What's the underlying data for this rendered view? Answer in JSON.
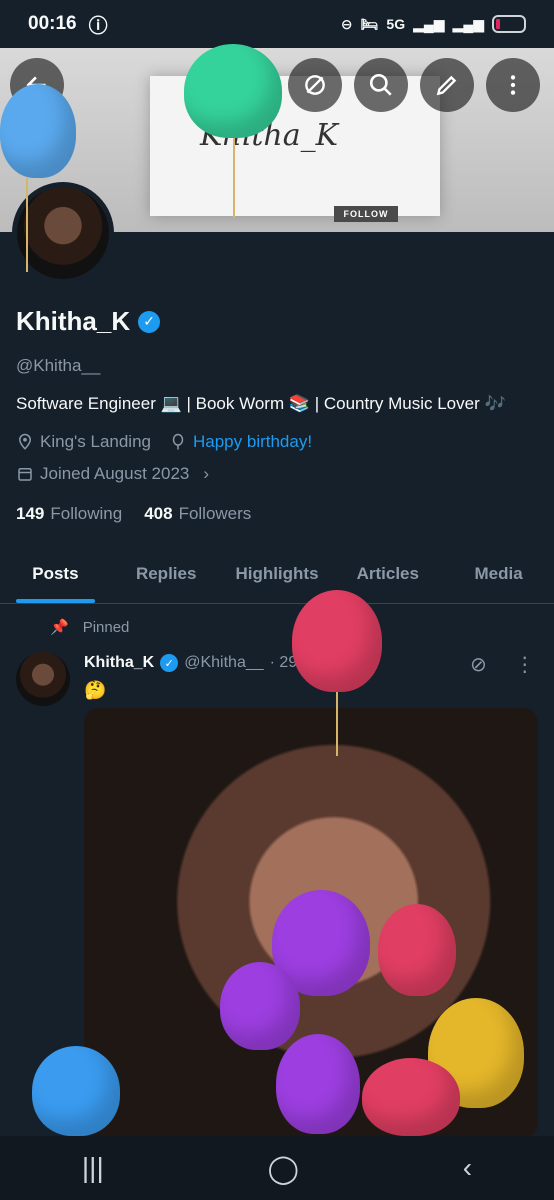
{
  "status_bar": {
    "time": "00:16",
    "network": "5G"
  },
  "banner": {
    "name_text": "Khitha_K",
    "follow_text": "FOLLOW"
  },
  "profile": {
    "display_name": "Khitha_K",
    "handle": "@Khitha__",
    "bio": "Software Engineer 💻 | Book Worm 📚 | Country Music Lover 🎶",
    "location": "King's Landing",
    "birthday_link": "Happy birthday!",
    "joined": "Joined August 2023",
    "following_count": "149",
    "following_label": "Following",
    "followers_count": "408",
    "followers_label": "Followers"
  },
  "tabs": [
    {
      "label": "Posts"
    },
    {
      "label": "Replies"
    },
    {
      "label": "Highlights"
    },
    {
      "label": "Articles"
    },
    {
      "label": "Media"
    }
  ],
  "post": {
    "pinned_label": "Pinned",
    "author": "Khitha_K",
    "handle": "@Khitha__",
    "date": "· 29 Jan",
    "content": "🤔"
  },
  "icons": {
    "back": "arrow-left-icon",
    "grok": "grok-icon",
    "search": "search-icon",
    "edit": "edit-icon",
    "more": "more-icon",
    "verified": "verified-icon",
    "location": "location-icon",
    "birthday": "balloon-icon",
    "calendar": "calendar-icon",
    "chevron": "chevron-right-icon",
    "pin": "pin-icon"
  },
  "colors": {
    "background": "#15202b",
    "accent": "#1d9bf0",
    "muted_text": "#8b98a5"
  }
}
